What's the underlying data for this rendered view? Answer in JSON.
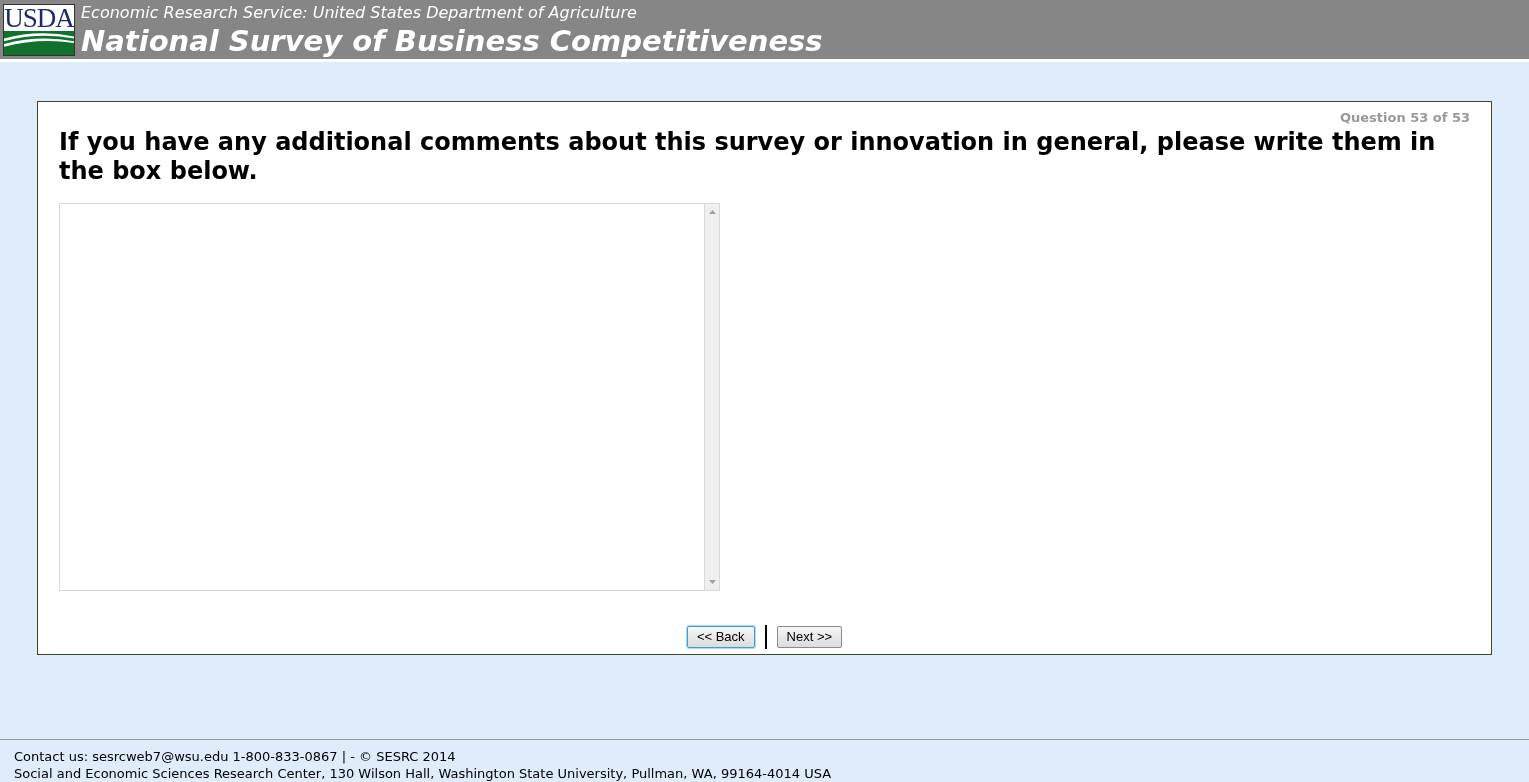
{
  "header": {
    "logo": "USDA",
    "agency": "Economic Research Service: United States Department of Agriculture",
    "title": "National Survey of Business Competitiveness"
  },
  "question": {
    "counter": "Question 53 of 53",
    "text": "If you have any additional comments about this survey or innovation in general, please write them in the box below."
  },
  "buttons": [
    {
      "label": "<< Back",
      "focused": true
    },
    {
      "label": "Next >>",
      "focused": false
    }
  ],
  "footer": {
    "contact": "Contact us: sesrcweb7@wsu.edu 1-800-833-0867 | - © SESRC 2014",
    "address": "Social and Economic Sciences Research Center, 130 Wilson Hall, Washington State University, Pullman, WA, 99164-4014 USA"
  }
}
